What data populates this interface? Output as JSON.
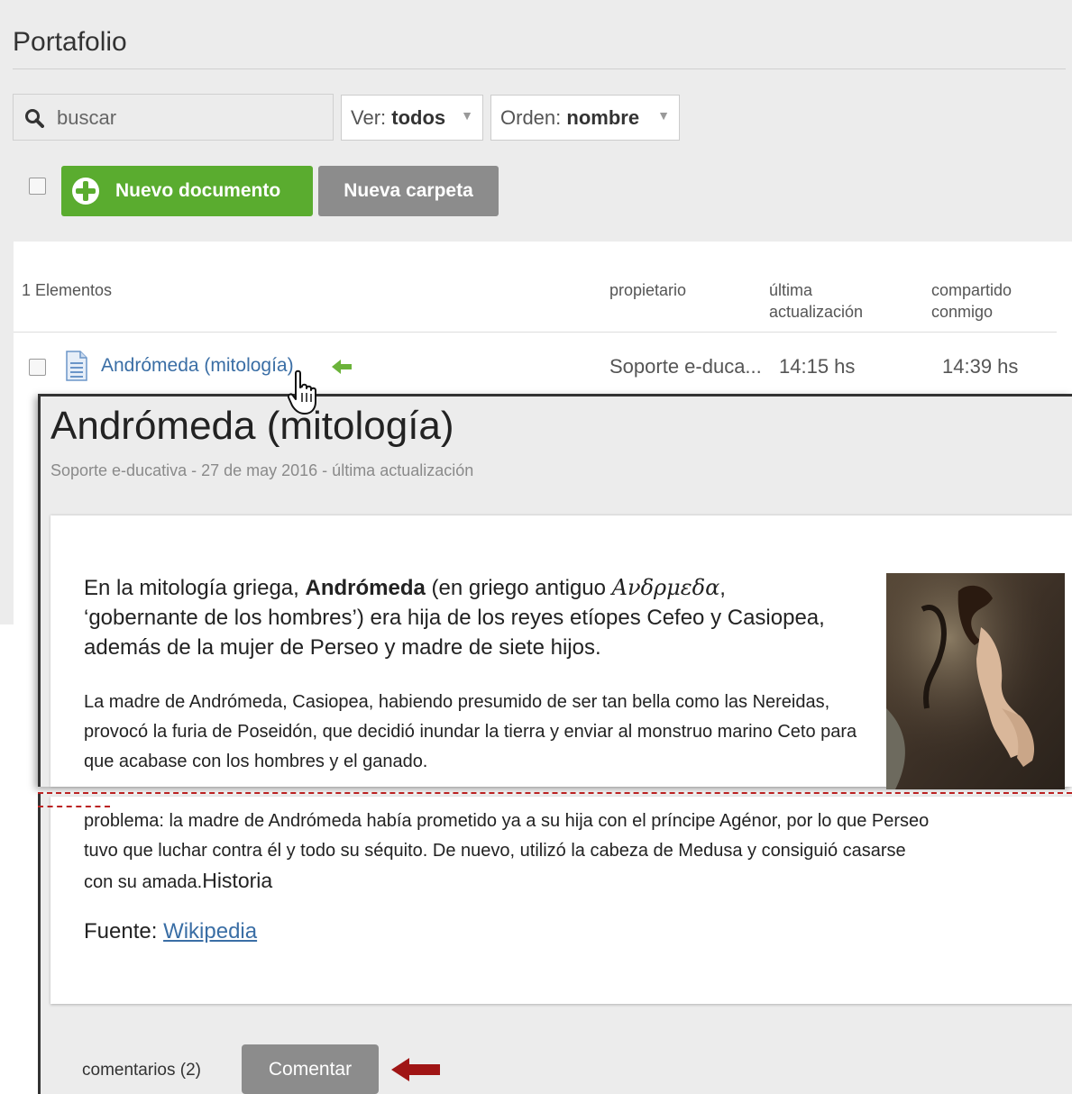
{
  "page": {
    "title": "Portafolio"
  },
  "toolbar": {
    "search_placeholder": "buscar",
    "ver_label": "Ver:",
    "ver_value": "todos",
    "orden_label": "Orden:",
    "orden_value": "nombre",
    "new_document_label": "Nuevo documento",
    "new_folder_label": "Nueva carpeta"
  },
  "list": {
    "count_label": "1 Elementos",
    "columns": {
      "owner": "propietario",
      "updated": "última actualización",
      "shared": "compartido conmigo"
    },
    "rows": [
      {
        "name": "Andrómeda (mitología)",
        "owner": "Soporte e-duca...",
        "updated": "14:15 hs",
        "shared": "14:39 hs"
      }
    ]
  },
  "document": {
    "title": "Andrómeda (mitología)",
    "meta": "Soporte e-ducativa - 27 de may 2016 - última actualización",
    "intro_pre": "En la mitología griega, ",
    "intro_bold": "Andrómeda",
    "intro_mid": " (en griego antiguo ",
    "intro_greek": "Ανδρμεδα",
    "intro_post": ", ‘gobernante de los hombres’) era hija de los reyes etíopes Cefeo y Casiopea, además de la mujer de Perseo y madre de siete hijos.",
    "paragraph": "La madre de Andrómeda, Casiopea, habiendo presumido de ser tan bella como las Nereidas, provocó la furia de Poseidón, que decidió inundar la tierra y enviar al monstruo marino Ceto para que acabase con los hombres y el ganado.",
    "paragraph2_line1": "problema: la madre de Andrómeda había prometido ya a su hija con el príncipe Agénor, por lo que Perseo",
    "paragraph2_line2": "tuvo que luchar contra él y todo su séquito. De nuevo, utilizó la cabeza de Medusa y consiguió casarse",
    "paragraph2_line3a": "con su amada.",
    "paragraph2_line3b": "Historia",
    "source_label": "Fuente: ",
    "source_link": "Wikipedia",
    "comments_label": "comentarios (2)",
    "comment_button": "Comentar"
  },
  "colors": {
    "green": "#5aac2f",
    "gray_button": "#8c8c8c",
    "link": "#3a6ea5",
    "annotation_red": "#a01515"
  },
  "icons": [
    "search-icon",
    "plus-circle-icon",
    "document-icon",
    "shared-arrow-icon",
    "hand-cursor-icon",
    "red-arrow-icon",
    "dropdown-caret-icon"
  ]
}
